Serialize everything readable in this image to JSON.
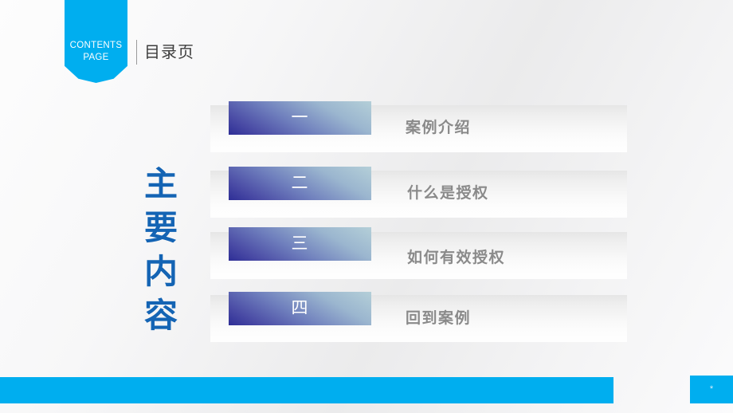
{
  "header": {
    "ribbon_line1": "CONTENTS",
    "ribbon_line2": "PAGE",
    "title": "目录页",
    "ribbon_color": "#00aeef",
    "title_color": "#3c3c3c"
  },
  "side_title": {
    "chars": [
      "主",
      "要",
      "内",
      "容"
    ],
    "color": "#1464b4"
  },
  "contents": {
    "items": [
      {
        "number": "一",
        "label": "案例介绍"
      },
      {
        "number": "二",
        "label": "什么是授权"
      },
      {
        "number": "三",
        "label": "如何有效授权"
      },
      {
        "number": "四",
        "label": "回到案例"
      }
    ],
    "number_gradient_from": "#2e2e96",
    "number_gradient_to": "#b4cfd8",
    "label_color": "#8a8a8a"
  },
  "footer": {
    "bar_color": "#00aeef",
    "page_number": "*"
  }
}
